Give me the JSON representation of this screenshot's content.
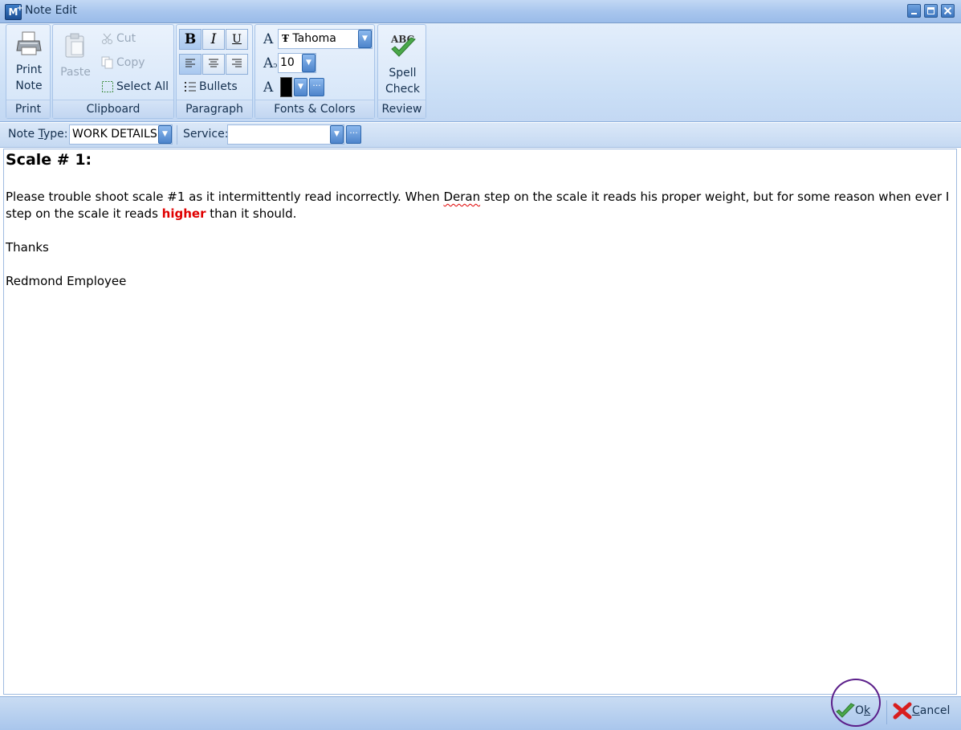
{
  "window": {
    "title": "Note Edit",
    "app_icon_text": "M"
  },
  "ribbon": {
    "print": {
      "button_line1": "Print",
      "button_line2": "Note",
      "group_label": "Print"
    },
    "clipboard": {
      "paste": "Paste",
      "cut": "Cut",
      "copy": "Copy",
      "select_all": "Select All",
      "group_label": "Clipboard"
    },
    "paragraph": {
      "bold": "B",
      "italic": "I",
      "underline": "U",
      "bullets": "Bullets",
      "group_label": "Paragraph"
    },
    "fonts": {
      "font_name": "Tahoma",
      "font_size": "10",
      "font_color": "#000000",
      "group_label": "Fonts & Colors"
    },
    "review": {
      "spell_line1": "Spell",
      "spell_line2": "Check",
      "abc": "ABC",
      "group_label": "Review"
    }
  },
  "note_bar": {
    "note_type_label_pre": "Note ",
    "note_type_label_key": "T",
    "note_type_label_post": "ype:",
    "note_type_value": "WORK DETAILS",
    "service_label": "Service:",
    "service_value": ""
  },
  "note": {
    "heading": "Scale # 1:",
    "p1_a": "Please trouble shoot scale #1 as it intermittently read incorrectly. When ",
    "p1_misspelled": "Deran",
    "p1_b": " step on the scale it reads his proper weight, but for some reason when ever I step on the scale it reads ",
    "p1_highlight": "higher",
    "p1_c": " than it should.",
    "p2": "Thanks",
    "p3": "Redmond Employee"
  },
  "footer": {
    "ok_pre": "O",
    "ok_key": "k",
    "cancel_key": "C",
    "cancel_rest": "ancel"
  },
  "colors": {
    "highlight": "#e00000",
    "accent": "#4d84cb"
  }
}
